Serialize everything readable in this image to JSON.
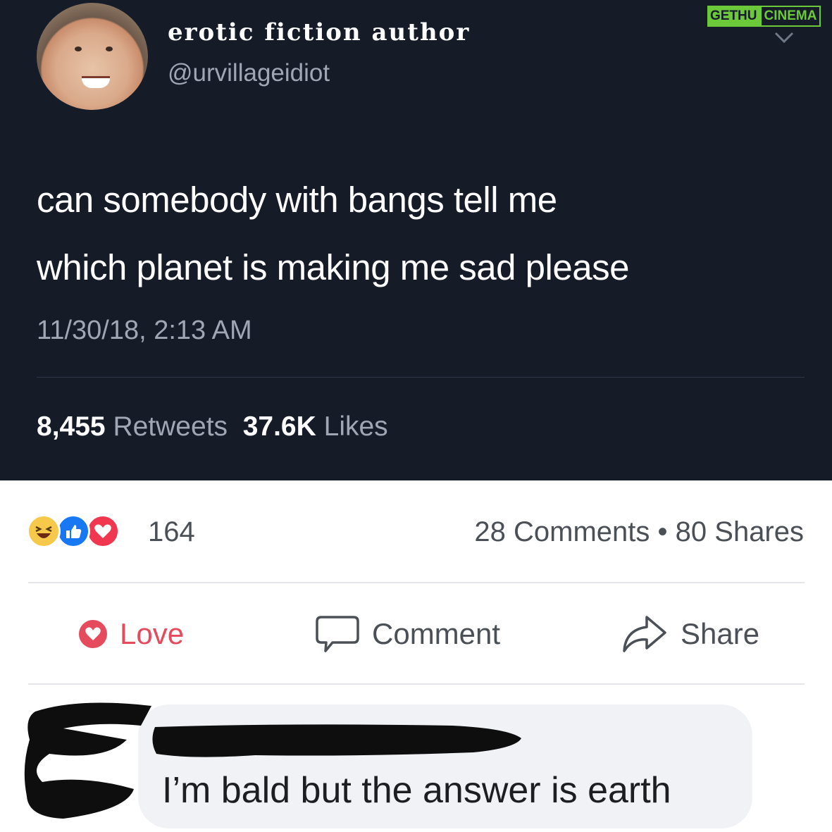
{
  "tweet": {
    "display_name": "erotic fiction author",
    "handle": "@urvillageidiot",
    "text_line1": "can somebody with bangs tell me",
    "text_line2": "which planet is making me sad please",
    "timestamp": "11/30/18, 2:13 AM",
    "retweets_count": "8,455",
    "retweets_label": "Retweets",
    "likes_count": "37.6K",
    "likes_label": "Likes",
    "menu_icon": "chevron-down-icon"
  },
  "watermark": {
    "part1": "GETHU",
    "part2": "CINEMA",
    "color": "#6cc93a"
  },
  "facebook": {
    "reactions": {
      "icons": [
        "haha-reaction-icon",
        "like-reaction-icon",
        "love-reaction-icon"
      ],
      "count": "164"
    },
    "comments_label": "28 Comments",
    "separator": "•",
    "shares_label": "80 Shares",
    "actions": {
      "love_label": "Love",
      "comment_label": "Comment",
      "share_label": "Share"
    },
    "comment": {
      "text": "I’m bald but the answer is earth"
    }
  },
  "colors": {
    "tweet_background": "#161b28",
    "tweet_muted": "#9fa7b4",
    "love_red": "#e64a5d",
    "fb_text": "#4b4f56",
    "bubble": "#f0f2f5"
  }
}
